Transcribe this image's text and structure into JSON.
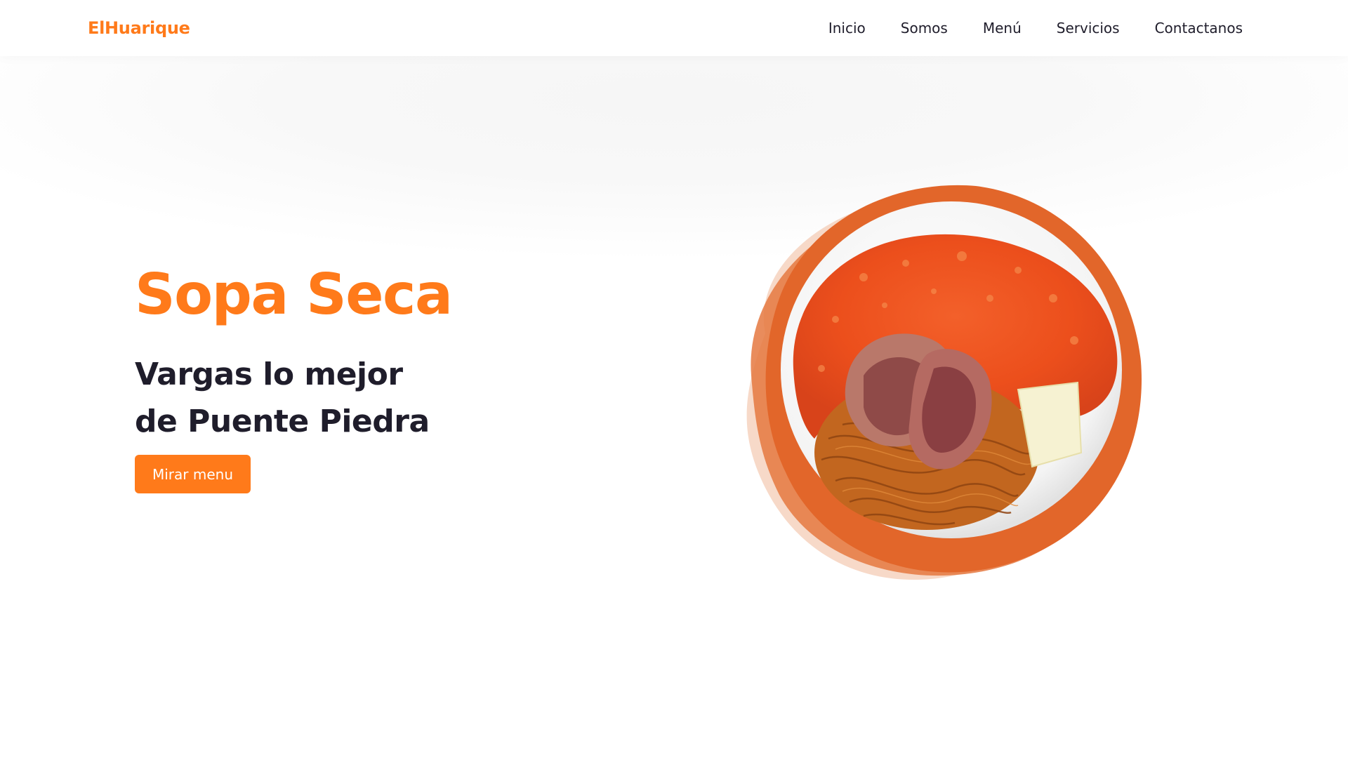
{
  "header": {
    "logo": "ElHuarique",
    "nav": [
      "Inicio",
      "Somos",
      "Menú",
      "Servicios",
      "Contactanos"
    ]
  },
  "hero": {
    "title": "Sopa Seca",
    "subtitle_line1": "Vargas lo mejor",
    "subtitle_line2": "de Puente Piedra",
    "button_label": "Mirar menu"
  },
  "colors": {
    "accent": "#ff7a1a",
    "text_dark": "#1f1d2b",
    "background": "#ffffff",
    "blob_orange": "#e2662a"
  },
  "icons": [
    "dish-illustration"
  ]
}
